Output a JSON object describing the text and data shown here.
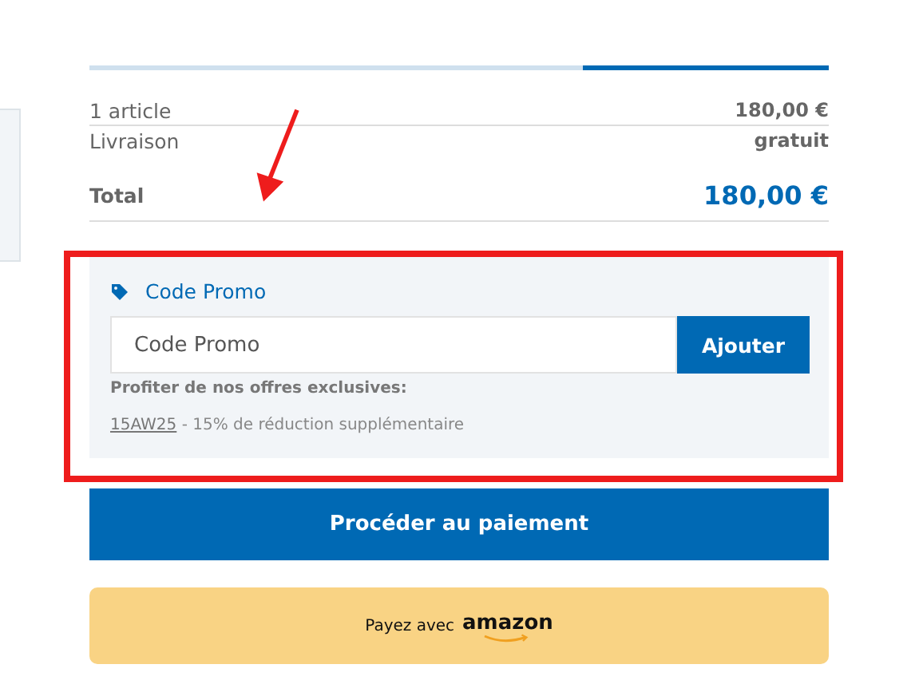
{
  "progress": {
    "steps": [
      {
        "selected": false
      },
      {
        "selected": false
      },
      {
        "selected": true
      }
    ]
  },
  "summary": {
    "rows": [
      {
        "label": "1 article",
        "value": "180,00 €"
      },
      {
        "label": "Livraison",
        "value": "gratuit"
      }
    ],
    "total": {
      "label": "Total",
      "value": "180,00 €"
    }
  },
  "promo": {
    "title": "Code Promo",
    "input": {
      "placeholder": "Code Promo"
    },
    "button": "Ajouter",
    "offers_heading": "Profiter de nos offres exclusives:",
    "offers": [
      {
        "code": "15AW25",
        "description": " - 15% de réduction supplémentaire"
      }
    ]
  },
  "checkout_button": "Procéder au paiement",
  "amazon_button": {
    "label": "Payez avec",
    "brand": "amazon"
  }
}
